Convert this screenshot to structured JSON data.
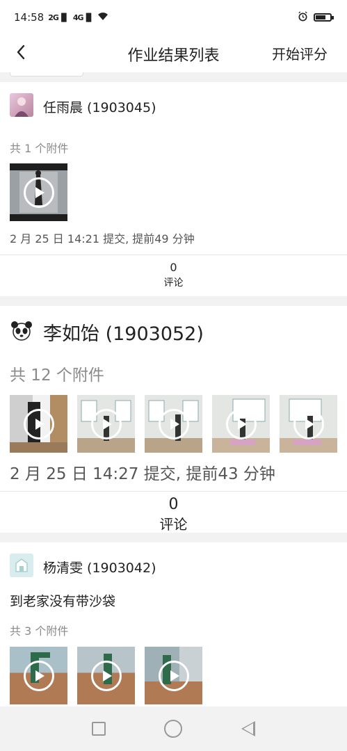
{
  "status_bar": {
    "time": "14:58",
    "signal_1": "2G",
    "signal_2": "4G"
  },
  "header": {
    "title": "作业结果列表",
    "action": "开始评分"
  },
  "submissions": [
    {
      "name": "任雨晨 (1903045)",
      "attachments": "共 1 个附件",
      "submitted": "2 月 25 日 14:21 提交, 提前49 分钟",
      "comment_count": "0",
      "comment_label": "评论"
    },
    {
      "name": "李如饴 (1903052)",
      "attachments": "共 12 个附件",
      "submitted": "2 月 25 日 14:27 提交, 提前43 分钟",
      "comment_count": "0",
      "comment_label": "评论"
    },
    {
      "name": "杨清雯 (1903042)",
      "note": "到老家没有带沙袋",
      "attachments": "共 3 个附件"
    }
  ],
  "icons": {
    "back": "chevron-left-icon",
    "play": "play-icon",
    "nav_recent": "square-icon",
    "nav_home": "circle-icon",
    "nav_back": "triangle-icon"
  }
}
